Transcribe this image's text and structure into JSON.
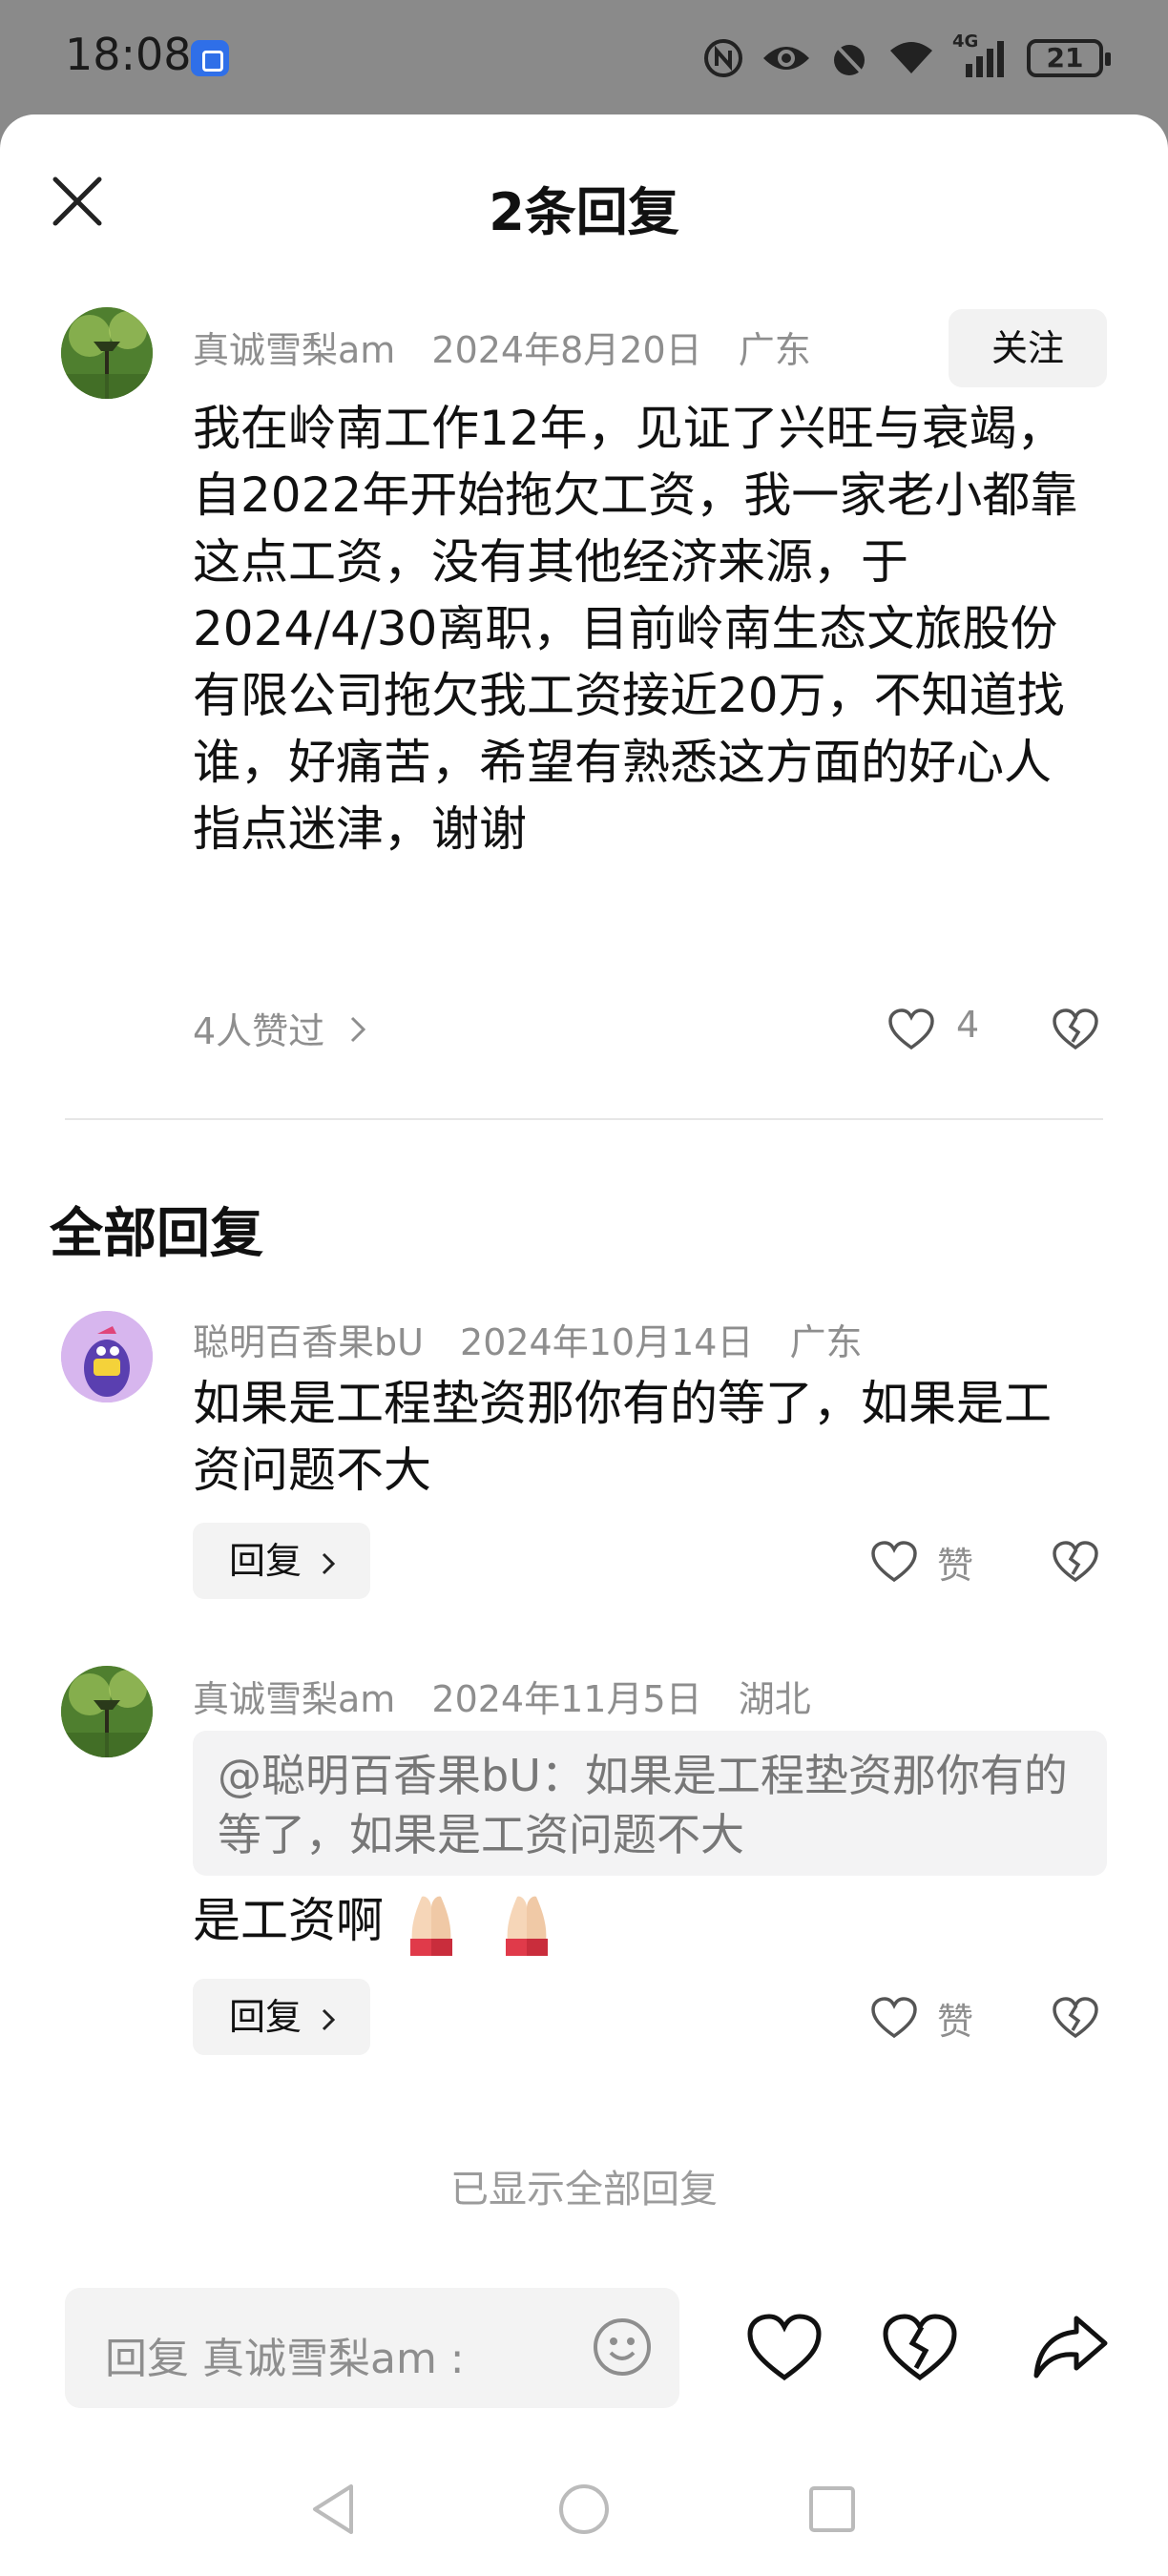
{
  "status": {
    "time": "18:08",
    "network": "4G",
    "battery": "21"
  },
  "sheet": {
    "title": "2条回复"
  },
  "post": {
    "username": "真诚雪梨am",
    "date": "2024年8月20日",
    "location": "广东",
    "follow_label": "关注",
    "body": "我在岭南工作12年，见证了兴旺与衰竭，自2022年开始拖欠工资，我一家老小都靠这点工资，没有其他经济来源，于2024/4/30离职，目前岭南生态文旅股份有限公司拖欠我工资接近20万，不知道找谁，好痛苦，希望有熟悉这方面的好心人指点迷津，谢谢",
    "likes_summary": "4人赞过",
    "like_count": "4"
  },
  "replies_section": {
    "title": "全部回复",
    "replies": [
      {
        "username": "聪明百香果bU",
        "date": "2024年10月14日",
        "location": "广东",
        "text": "如果是工程垫资那你有的等了，如果是工资问题不大",
        "reply_label": "回复",
        "like_label": "赞"
      },
      {
        "username": "真诚雪梨am",
        "date": "2024年11月5日",
        "location": "湖北",
        "quote": "@聪明百香果bU：如果是工程垫资那你有的等了，如果是工资问题不大",
        "text": "是工资啊",
        "reply_label": "回复",
        "like_label": "赞"
      }
    ],
    "end_note": "已显示全部回复"
  },
  "input": {
    "placeholder": "回复 真诚雪梨am :"
  },
  "icons": {
    "close": "close-icon",
    "like": "heart-icon",
    "dislike": "broken-heart-icon",
    "share": "share-icon",
    "emoji": "smiley-icon",
    "nav_back": "triangle-back-icon",
    "nav_home": "circle-home-icon",
    "nav_recents": "square-recents-icon"
  },
  "colors": {
    "secondary_text": "#8e8e8e",
    "button_bg": "#f3f3f3"
  }
}
